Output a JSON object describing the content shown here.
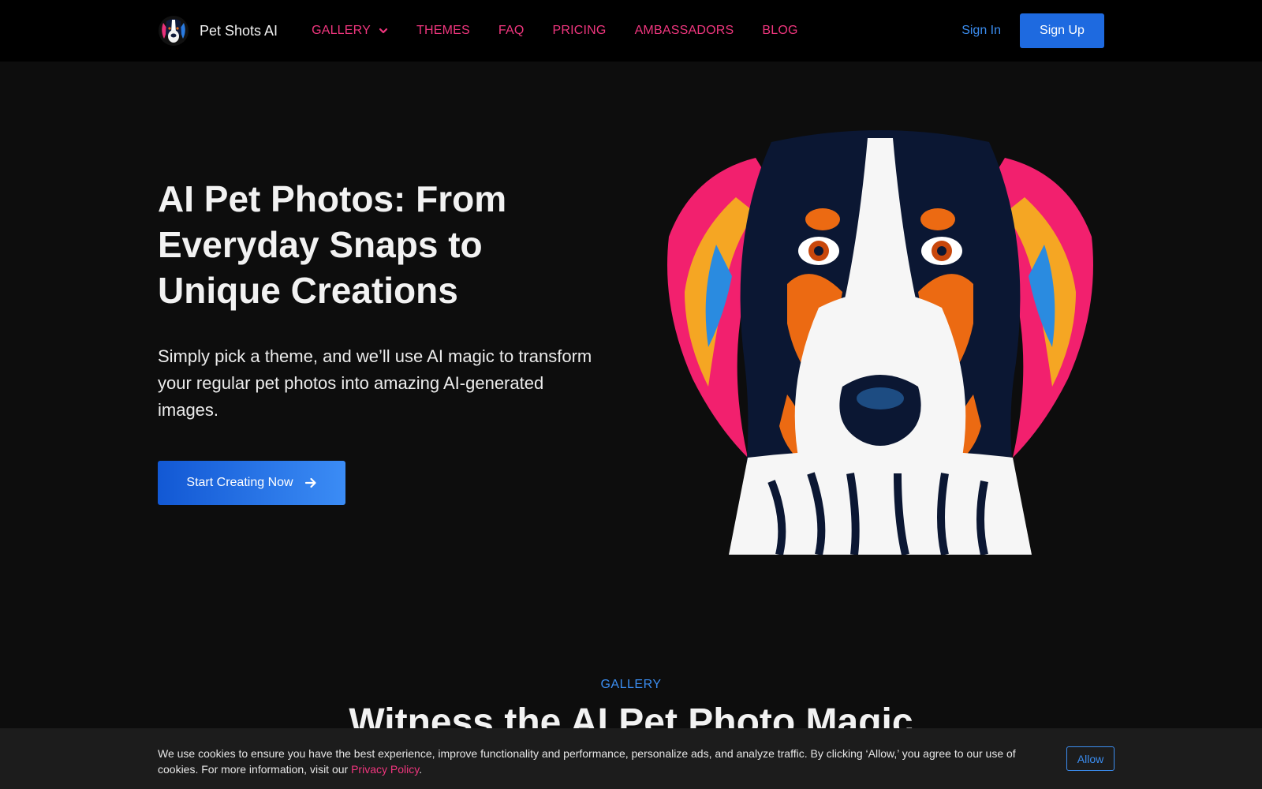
{
  "header": {
    "brand": "Pet Shots AI",
    "nav": [
      {
        "label": "GALLERY"
      },
      {
        "label": "THEMES"
      },
      {
        "label": "FAQ"
      },
      {
        "label": "PRICING"
      },
      {
        "label": "AMBASSADORS"
      },
      {
        "label": "BLOG"
      }
    ],
    "sign_in": "Sign In",
    "sign_up": "Sign Up"
  },
  "hero": {
    "title": "AI Pet Photos: From Everyday Snaps to Unique Creations",
    "subtitle": "Simply pick a theme, and we’ll use AI magic to transform your regular pet photos into amazing AI-generated images.",
    "cta": "Start Creating Now"
  },
  "gallery": {
    "label": "GALLERY",
    "title": "Witness the AI Pet Photo Magic"
  },
  "cookie": {
    "text": "We use cookies to ensure you have the best experience, improve functionality and performance, personalize ads, and analyze traffic. By clicking ‘Allow,’ you agree to our use of cookies. For more information, visit our ",
    "link": "Privacy Policy",
    "after": ".",
    "allow": "Allow"
  },
  "colors": {
    "accent_pink": "#f0367e",
    "accent_blue": "#3b8df0",
    "button_blue": "#1e6ae0",
    "background": "#0d0d0d"
  }
}
